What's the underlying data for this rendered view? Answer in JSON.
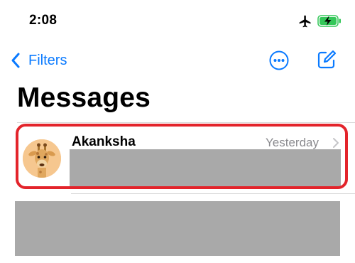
{
  "status_bar": {
    "time": "2:08"
  },
  "nav": {
    "back_label": "Filters"
  },
  "page": {
    "title": "Messages"
  },
  "conversations": [
    {
      "name": "Akanksha",
      "timestamp": "Yesterday"
    }
  ],
  "icons": {
    "status": [
      "airplane-icon",
      "battery-charging-icon"
    ],
    "toolbar": [
      "chevron-left-icon",
      "more-icon",
      "compose-icon"
    ],
    "row": [
      "avatar-giraffe",
      "chevron-right-icon"
    ]
  },
  "colors": {
    "accent": "#0a7aff",
    "highlight": "#e3242b",
    "battery": "#34c759",
    "redacted": "#a9a9a9",
    "secondary_text": "#8a8a8e"
  }
}
